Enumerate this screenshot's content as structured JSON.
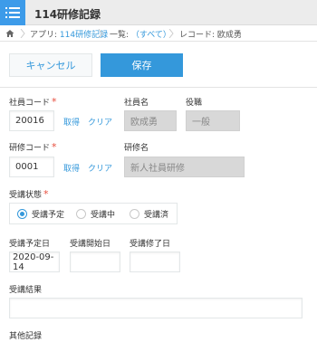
{
  "header": {
    "title": "114研修記録"
  },
  "breadcrumb": {
    "app_prefix": "アプリ: ",
    "app_name": "114研修記録",
    "list_prefix": "一覧: ",
    "list_name": "（すべて）",
    "record": "レコード: 欧成勇"
  },
  "actions": {
    "cancel_label": "キャンセル",
    "save_label": "保存"
  },
  "form": {
    "employee_code": {
      "label": "社員コード",
      "required": "*",
      "value": "20016",
      "fetch_label": "取得",
      "clear_label": "クリア"
    },
    "employee_name": {
      "label": "社員名",
      "value": "欧成勇"
    },
    "position": {
      "label": "役職",
      "value": "一般"
    },
    "training_code": {
      "label": "研修コード",
      "required": "*",
      "value": "0001",
      "fetch_label": "取得",
      "clear_label": "クリア"
    },
    "training_name": {
      "label": "研修名",
      "value": "新人社員研修"
    },
    "status": {
      "label": "受講状態",
      "required": "*",
      "options": [
        "受講予定",
        "受講中",
        "受講済"
      ],
      "selected": "受講予定"
    },
    "planned_date": {
      "label": "受講予定日",
      "value": "2020-09-14"
    },
    "start_date": {
      "label": "受講開始日",
      "value": ""
    },
    "end_date": {
      "label": "受講修了日",
      "value": ""
    },
    "result": {
      "label": "受講結果",
      "value": ""
    },
    "other": {
      "label": "其他記録"
    }
  },
  "colors": {
    "accent": "#3498db",
    "required": "#e74c3c",
    "header_bg": "#ececec"
  }
}
